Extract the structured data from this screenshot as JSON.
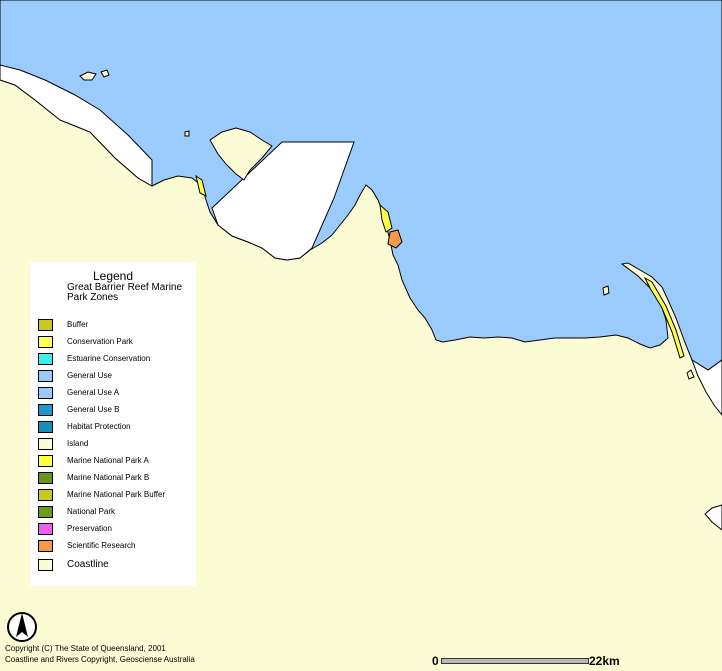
{
  "legend": {
    "title": "Legend",
    "subtitle": "Great Barrier Reef Marine Park Zones",
    "items": [
      {
        "label": "Buffer",
        "color": "#c8c81e"
      },
      {
        "label": "Conservation Park",
        "color": "#ffff50"
      },
      {
        "label": "Estuarine Conservation",
        "color": "#3cf0f0"
      },
      {
        "label": "General Use",
        "color": "#9bcbfd"
      },
      {
        "label": "General Use A",
        "color": "#9bcbfd"
      },
      {
        "label": "General Use B",
        "color": "#2196cc"
      },
      {
        "label": "Habitat Protection",
        "color": "#1591b9"
      },
      {
        "label": "Island",
        "color": "#fcfcd4"
      },
      {
        "label": "Marine National Park A",
        "color": "#ffff3c"
      },
      {
        "label": "Marine National Park B",
        "color": "#6a961e"
      },
      {
        "label": "Marine National Park Buffer",
        "color": "#c8c81e"
      },
      {
        "label": "National Park",
        "color": "#6a9a1e"
      },
      {
        "label": "Preservation",
        "color": "#f060f0"
      },
      {
        "label": "Scientific Research",
        "color": "#f49a4a"
      },
      {
        "label": "Coastline",
        "color": "#fcfcd4"
      }
    ]
  },
  "copyright": {
    "line1": "Copyright (C) The State of Queensland, 2001",
    "line2": "Coastline and Rivers Copyright, Geosciense Australia"
  },
  "scale": {
    "zero_label": "0",
    "max_label": "22km"
  },
  "colors": {
    "sea": "#9bcbfd",
    "land": "#fcfcd4",
    "white_zone": "#ffffff"
  }
}
